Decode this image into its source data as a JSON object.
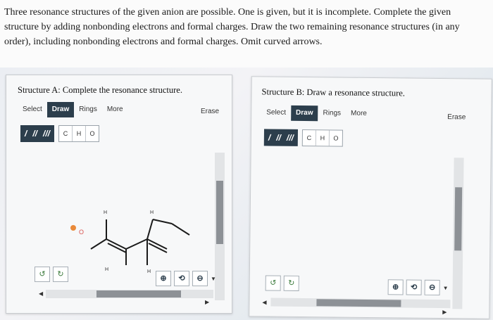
{
  "question": {
    "text": "Three resonance structures of the given anion are possible. One is given, but it is incomplete. Complete the given structure by adding nonbonding electrons and formal charges. Draw the two remaining resonance structures (in any order), including nonbonding electrons and formal charges. Omit curved arrows."
  },
  "panelA": {
    "title": "Structure A: Complete the resonance structure.",
    "menu": [
      "Select",
      "Draw",
      "Rings",
      "More"
    ],
    "erase": "Erase",
    "bonds": [
      "/",
      "//",
      "///"
    ],
    "atoms": [
      "C",
      "H",
      "O"
    ],
    "molecule_labels": {
      "o": "O",
      "h1": "H",
      "h2": "H",
      "h3": "H",
      "h4": "H"
    },
    "undo_icons": [
      "undo-icon",
      "redo-icon"
    ],
    "zoom_icons": [
      "zoom-in-icon",
      "zoom-reset-icon",
      "zoom-out-icon"
    ]
  },
  "panelB": {
    "title": "Structure B: Draw a resonance structure.",
    "menu": [
      "Select",
      "Draw",
      "Rings",
      "More"
    ],
    "erase": "Erase",
    "bonds": [
      "/",
      "//",
      "///"
    ],
    "atoms": [
      "C",
      "H",
      "O"
    ],
    "undo_icons": [
      "undo-icon",
      "redo-icon"
    ],
    "zoom_icons": [
      "zoom-in-icon",
      "zoom-reset-icon",
      "zoom-out-icon"
    ]
  },
  "colors": {
    "toolbar_dark": "#2c3e4c",
    "panel_bg": "#f7f8f9",
    "oxygen_red": "#d9534f"
  }
}
